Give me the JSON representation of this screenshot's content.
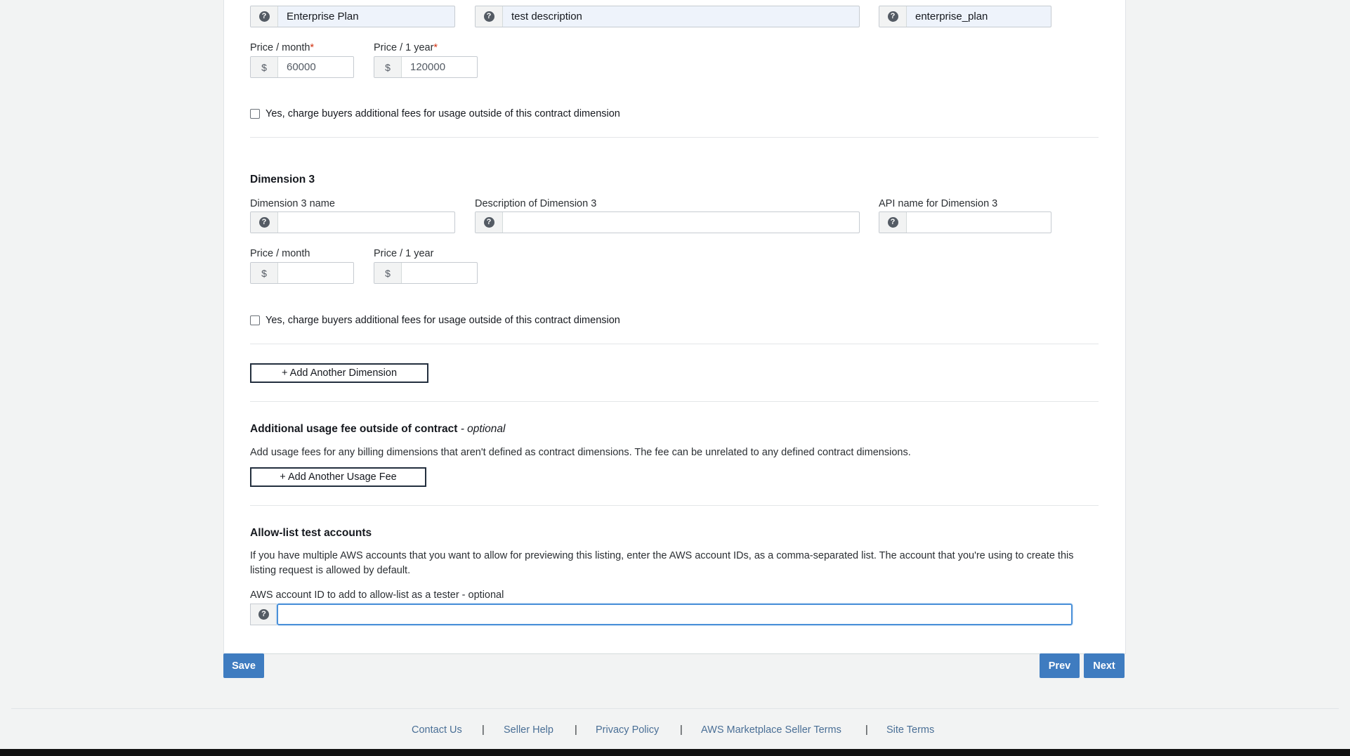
{
  "dimension2": {
    "name_value": "Enterprise Plan",
    "description_value": "test description",
    "api_name_value": "enterprise_plan",
    "price_month_label": "Price / month",
    "price_month_value": "60000",
    "price_year_label": "Price / 1 year",
    "price_year_value": "120000",
    "required_mark": "*",
    "currency": "$",
    "checkbox_label": "Yes, charge buyers additional fees for usage outside of this contract dimension"
  },
  "dimension3": {
    "title": "Dimension 3",
    "name_label": "Dimension 3 name",
    "description_label": "Description of Dimension 3",
    "api_name_label": "API name for Dimension 3",
    "price_month_label": "Price / month",
    "price_year_label": "Price / 1 year",
    "currency": "$",
    "checkbox_label": "Yes, charge buyers additional fees for usage outside of this contract dimension"
  },
  "add_dimension_label": "+ Add Another Dimension",
  "usage_fee": {
    "title": "Additional usage fee outside of contract",
    "optional_suffix": " - optional",
    "description": "Add usage fees for any billing dimensions that aren't defined as contract dimensions. The fee can be unrelated to any defined contract dimensions.",
    "button_label": "+ Add Another Usage Fee"
  },
  "allow_list": {
    "title": "Allow-list test accounts",
    "description": "If you have multiple AWS accounts that you want to allow for previewing this listing, enter the AWS account IDs, as a comma-separated list. The account that you're using to create this listing request is allowed by default.",
    "input_label": "AWS account ID to add to allow-list as a tester - optional",
    "input_value": ""
  },
  "actions": {
    "save": "Save",
    "prev": "Prev",
    "next": "Next"
  },
  "footer": {
    "links": [
      "Contact Us",
      "Seller Help",
      "Privacy Policy",
      "AWS Marketplace Seller Terms",
      "Site Terms"
    ],
    "separator": "|"
  },
  "icons": {
    "help": "question-circle-icon"
  },
  "colors": {
    "primary_button": "#3f7cc0",
    "required": "#d13212",
    "footer_link": "#4a6f96"
  }
}
